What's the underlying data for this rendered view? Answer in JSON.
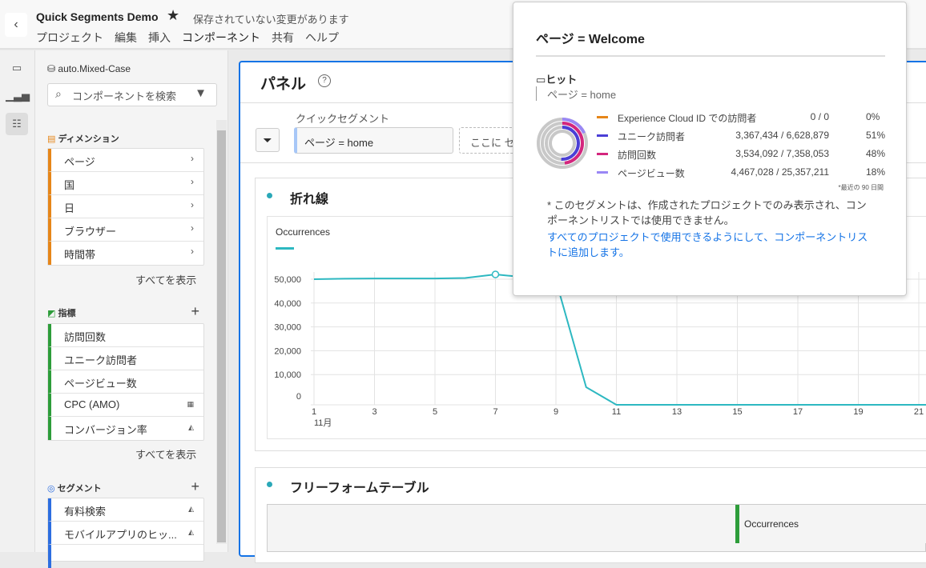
{
  "header": {
    "title": "Quick Segments Demo",
    "unsaved": "保存されていない変更があります",
    "menu": [
      "プロジェクト",
      "編集",
      "挿入",
      "コンポーネント",
      "共有",
      "ヘルプ"
    ]
  },
  "components": {
    "report_suite": "auto.Mixed-Case",
    "search_placeholder": "コンポーネントを検索",
    "show_all": "すべてを表示",
    "dimensions": {
      "title": "ディメンション",
      "items": [
        "ページ",
        "国",
        "日",
        "ブラウザー",
        "時間帯"
      ]
    },
    "metrics": {
      "title": "指標",
      "items": [
        "訪問回数",
        "ユニーク訪問者",
        "ページビュー数",
        "CPC (AMO)",
        "コンバージョン率"
      ]
    },
    "segments": {
      "title": "セグメント",
      "items": [
        "有料検索",
        "モバイルアプリのヒッ..."
      ]
    }
  },
  "panel": {
    "title": "パネル",
    "quick_segment_label": "クイックセグメント",
    "segment": "ページ = home",
    "drop_placeholder": "ここに セ"
  },
  "line_viz": {
    "title": "折れ線",
    "legend": "Occurrences"
  },
  "table_viz": {
    "title": "フリーフォームテーブル",
    "column": "Occurrences"
  },
  "popover": {
    "title": "ページ = Welcome",
    "container": "ヒット",
    "condition": "ページ = home",
    "rows": [
      {
        "label": "Experience Cloud ID での訪問者",
        "value": "0 / 0",
        "pct": "0%",
        "color": "#e68619",
        "frac": 0
      },
      {
        "label": "ユニーク訪問者",
        "value": "3,367,434 / 6,628,879",
        "pct": "51%",
        "color": "#4b3fd6",
        "frac": 0.51
      },
      {
        "label": "訪問回数",
        "value": "3,534,092 / 7,358,053",
        "pct": "48%",
        "color": "#d4267e",
        "frac": 0.48
      },
      {
        "label": "ページビュー数",
        "value": "4,467,028 / 25,357,211",
        "pct": "18%",
        "color": "#9a87f5",
        "frac": 0.18
      }
    ],
    "footnote": "*最近の 90 日間",
    "note": "* このセグメントは、作成されたプロジェクトでのみ表示され、コンポーネントリストでは使用できません。",
    "link": "すべてのプロジェクトで使用できるようにして、コンポーネントリストに追加します。"
  },
  "colors": {
    "accent": "#1473e6",
    "dimension": "#e68619",
    "metric": "#2d9d3a",
    "segment": "#2d6ee0",
    "series": "#2db8c1"
  },
  "chart_data": {
    "type": "line",
    "series": [
      {
        "name": "Occurrences",
        "x": [
          1,
          2,
          3,
          4,
          5,
          6,
          7,
          8,
          9,
          10,
          11,
          12,
          13,
          14,
          15,
          16,
          17,
          18,
          19,
          20,
          21,
          22
        ],
        "values": [
          50000,
          50200,
          50300,
          50300,
          50300,
          50500,
          52000,
          50800,
          49500,
          4700,
          0,
          0,
          0,
          0,
          0,
          0,
          0,
          0,
          0,
          0,
          0,
          0
        ]
      }
    ],
    "x_ticks": [
      "1",
      "3",
      "5",
      "7",
      "9",
      "11",
      "13",
      "15",
      "17",
      "19",
      "21"
    ],
    "x_sublabel": "11月",
    "y_ticks": [
      "0",
      "10,000",
      "20,000",
      "30,000",
      "40,000",
      "50,000"
    ],
    "ylim": [
      0,
      50000
    ],
    "xlim": [
      1,
      21
    ],
    "grid": true
  }
}
